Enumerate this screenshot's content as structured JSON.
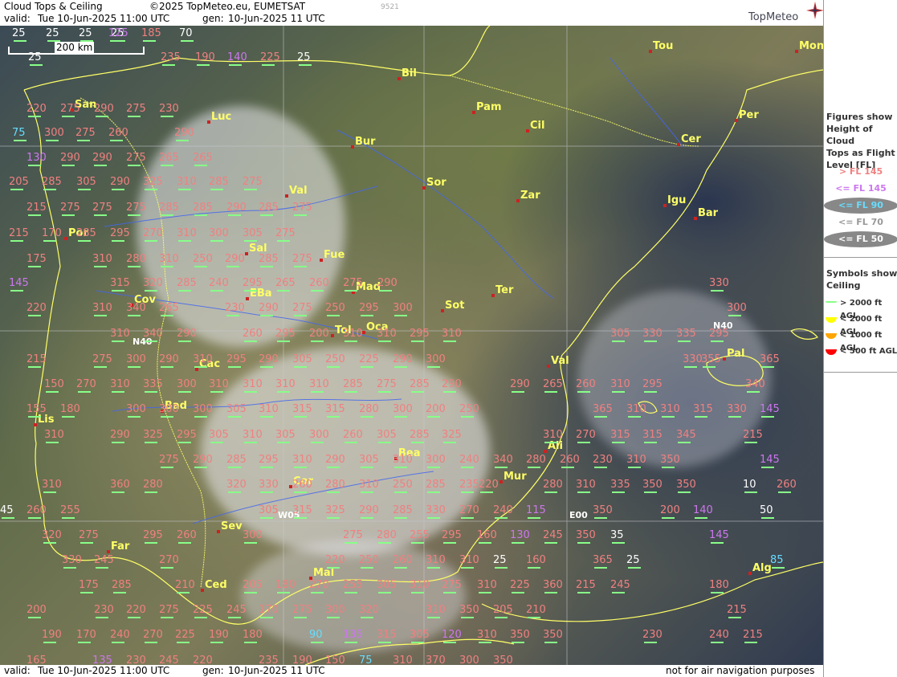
{
  "header": {
    "product": "Cloud Tops & Ceiling",
    "copyright": "©2025 TopMeteo.eu, EUMETSAT",
    "code": "9521",
    "valid_label": "valid:",
    "valid_value": "Tue   10-Jun-2025   11:00 UTC",
    "gen_label": "gen:",
    "gen_value": "10-Jun-2025 11 UTC",
    "logo": "TopMeteo"
  },
  "footer": {
    "valid_label": "valid:",
    "valid_value": "Tue   10-Jun-2025   11:00 UTC",
    "gen_label": "gen:",
    "gen_value": "10-Jun-2025 11 UTC",
    "disclaimer": "not for air navigation purposes"
  },
  "scale": {
    "label": "200 km"
  },
  "grid_labels": [
    {
      "text": "N40"
    },
    {
      "text": "N40"
    },
    {
      "text": "W05"
    },
    {
      "text": "E00"
    }
  ],
  "cities": [
    {
      "name": "Tou"
    },
    {
      "name": "Mon"
    },
    {
      "name": "Bil"
    },
    {
      "name": "Pam"
    },
    {
      "name": "Cil"
    },
    {
      "name": "Per"
    },
    {
      "name": "Luc"
    },
    {
      "name": "Bur"
    },
    {
      "name": "Cer"
    },
    {
      "name": "Sor"
    },
    {
      "name": "Zar"
    },
    {
      "name": "Igu"
    },
    {
      "name": "Bar"
    },
    {
      "name": "Val"
    },
    {
      "name": "Por"
    },
    {
      "name": "Sal"
    },
    {
      "name": "Fue"
    },
    {
      "name": "Mad"
    },
    {
      "name": "Cov"
    },
    {
      "name": "EBa"
    },
    {
      "name": "Ter"
    },
    {
      "name": "Sot"
    },
    {
      "name": "Oca"
    },
    {
      "name": "Tol"
    },
    {
      "name": "Pal"
    },
    {
      "name": "Val"
    },
    {
      "name": "Cac"
    },
    {
      "name": "Bad"
    },
    {
      "name": "Lis"
    },
    {
      "name": "Bea"
    },
    {
      "name": "Ali"
    },
    {
      "name": "Mur"
    },
    {
      "name": "Cor"
    },
    {
      "name": "Sev"
    },
    {
      "name": "Far"
    },
    {
      "name": "Mal"
    },
    {
      "name": "Alg"
    },
    {
      "name": "Ced"
    },
    {
      "name": "San"
    }
  ],
  "values": [
    {
      "v": "25",
      "c": "vlo"
    },
    {
      "v": "25",
      "c": "vlo"
    },
    {
      "v": "25",
      "c": "vlo"
    },
    {
      "v": "25",
      "c": "vlo"
    },
    {
      "v": "125",
      "c": "mid"
    },
    {
      "v": "185",
      "c": "hi"
    },
    {
      "v": "70",
      "c": "vlo"
    },
    {
      "v": "25",
      "c": "vlo"
    },
    {
      "v": "235",
      "c": "hi"
    },
    {
      "v": "190",
      "c": "hi"
    },
    {
      "v": "140",
      "c": "mid"
    },
    {
      "v": "225",
      "c": "hi"
    },
    {
      "v": "25",
      "c": "vlo"
    },
    {
      "v": "220",
      "c": "hi"
    },
    {
      "v": "275",
      "c": "hi"
    },
    {
      "v": "290",
      "c": "hi"
    },
    {
      "v": "275",
      "c": "hi"
    },
    {
      "v": "230",
      "c": "hi"
    },
    {
      "v": "75",
      "c": "lo"
    },
    {
      "v": "300",
      "c": "hi"
    },
    {
      "v": "275",
      "c": "hi"
    },
    {
      "v": "260",
      "c": "hi"
    },
    {
      "v": "290",
      "c": "hi"
    },
    {
      "v": "130",
      "c": "mid"
    },
    {
      "v": "290",
      "c": "hi"
    },
    {
      "v": "290",
      "c": "hi"
    },
    {
      "v": "275",
      "c": "hi"
    },
    {
      "v": "265",
      "c": "hi"
    },
    {
      "v": "265",
      "c": "hi"
    },
    {
      "v": "205",
      "c": "hi"
    },
    {
      "v": "285",
      "c": "hi"
    },
    {
      "v": "305",
      "c": "hi"
    },
    {
      "v": "290",
      "c": "hi"
    },
    {
      "v": "325",
      "c": "hi"
    },
    {
      "v": "310",
      "c": "hi"
    },
    {
      "v": "285",
      "c": "hi"
    },
    {
      "v": "275",
      "c": "hi"
    },
    {
      "v": "215",
      "c": "hi"
    },
    {
      "v": "275",
      "c": "hi"
    },
    {
      "v": "275",
      "c": "hi"
    },
    {
      "v": "275",
      "c": "hi"
    },
    {
      "v": "285",
      "c": "hi"
    },
    {
      "v": "285",
      "c": "hi"
    },
    {
      "v": "290",
      "c": "hi"
    },
    {
      "v": "285",
      "c": "hi"
    },
    {
      "v": "275",
      "c": "hi"
    },
    {
      "v": "215",
      "c": "hi"
    },
    {
      "v": "170",
      "c": "hi"
    },
    {
      "v": "285",
      "c": "hi"
    },
    {
      "v": "295",
      "c": "hi"
    },
    {
      "v": "270",
      "c": "hi"
    },
    {
      "v": "310",
      "c": "hi"
    },
    {
      "v": "300",
      "c": "hi"
    },
    {
      "v": "305",
      "c": "hi"
    },
    {
      "v": "275",
      "c": "hi"
    },
    {
      "v": "175",
      "c": "hi"
    },
    {
      "v": "310",
      "c": "hi"
    },
    {
      "v": "280",
      "c": "hi"
    },
    {
      "v": "310",
      "c": "hi"
    },
    {
      "v": "250",
      "c": "hi"
    },
    {
      "v": "290",
      "c": "hi"
    },
    {
      "v": "285",
      "c": "hi"
    },
    {
      "v": "275",
      "c": "hi"
    },
    {
      "v": "145",
      "c": "mid"
    },
    {
      "v": "315",
      "c": "hi"
    },
    {
      "v": "320",
      "c": "hi"
    },
    {
      "v": "285",
      "c": "hi"
    },
    {
      "v": "240",
      "c": "hi"
    },
    {
      "v": "295",
      "c": "hi"
    },
    {
      "v": "265",
      "c": "hi"
    },
    {
      "v": "260",
      "c": "hi"
    },
    {
      "v": "275",
      "c": "hi"
    },
    {
      "v": "290",
      "c": "hi"
    },
    {
      "v": "330",
      "c": "hi"
    },
    {
      "v": "220",
      "c": "hi"
    },
    {
      "v": "310",
      "c": "hi"
    },
    {
      "v": "340",
      "c": "hi"
    },
    {
      "v": "265",
      "c": "hi"
    },
    {
      "v": "230",
      "c": "hi"
    },
    {
      "v": "290",
      "c": "hi"
    },
    {
      "v": "275",
      "c": "hi"
    },
    {
      "v": "250",
      "c": "hi"
    },
    {
      "v": "295",
      "c": "hi"
    },
    {
      "v": "300",
      "c": "hi"
    },
    {
      "v": "300",
      "c": "hi"
    },
    {
      "v": "310",
      "c": "hi"
    },
    {
      "v": "340",
      "c": "hi"
    },
    {
      "v": "290",
      "c": "hi"
    },
    {
      "v": "260",
      "c": "hi"
    },
    {
      "v": "295",
      "c": "hi"
    },
    {
      "v": "200",
      "c": "hi"
    },
    {
      "v": "310",
      "c": "hi"
    },
    {
      "v": "310",
      "c": "hi"
    },
    {
      "v": "295",
      "c": "hi"
    },
    {
      "v": "310",
      "c": "hi"
    },
    {
      "v": "305",
      "c": "hi"
    },
    {
      "v": "330",
      "c": "hi"
    },
    {
      "v": "335",
      "c": "hi"
    },
    {
      "v": "295",
      "c": "hi"
    },
    {
      "v": "215",
      "c": "hi"
    },
    {
      "v": "275",
      "c": "hi"
    },
    {
      "v": "300",
      "c": "hi"
    },
    {
      "v": "290",
      "c": "hi"
    },
    {
      "v": "310",
      "c": "hi"
    },
    {
      "v": "295",
      "c": "hi"
    },
    {
      "v": "290",
      "c": "hi"
    },
    {
      "v": "305",
      "c": "hi"
    },
    {
      "v": "250",
      "c": "hi"
    },
    {
      "v": "225",
      "c": "hi"
    },
    {
      "v": "290",
      "c": "hi"
    },
    {
      "v": "300",
      "c": "hi"
    },
    {
      "v": "330",
      "c": "hi"
    },
    {
      "v": "355",
      "c": "hi"
    },
    {
      "v": "365",
      "c": "hi"
    },
    {
      "v": "150",
      "c": "hi"
    },
    {
      "v": "270",
      "c": "hi"
    },
    {
      "v": "310",
      "c": "hi"
    },
    {
      "v": "335",
      "c": "hi"
    },
    {
      "v": "300",
      "c": "hi"
    },
    {
      "v": "310",
      "c": "hi"
    },
    {
      "v": "310",
      "c": "hi"
    },
    {
      "v": "310",
      "c": "hi"
    },
    {
      "v": "310",
      "c": "hi"
    },
    {
      "v": "285",
      "c": "hi"
    },
    {
      "v": "275",
      "c": "hi"
    },
    {
      "v": "285",
      "c": "hi"
    },
    {
      "v": "290",
      "c": "hi"
    },
    {
      "v": "290",
      "c": "hi"
    },
    {
      "v": "265",
      "c": "hi"
    },
    {
      "v": "260",
      "c": "hi"
    },
    {
      "v": "310",
      "c": "hi"
    },
    {
      "v": "295",
      "c": "hi"
    },
    {
      "v": "340",
      "c": "hi"
    },
    {
      "v": "155",
      "c": "hi"
    },
    {
      "v": "180",
      "c": "hi"
    },
    {
      "v": "300",
      "c": "hi"
    },
    {
      "v": "300",
      "c": "hi"
    },
    {
      "v": "300",
      "c": "hi"
    },
    {
      "v": "305",
      "c": "hi"
    },
    {
      "v": "310",
      "c": "hi"
    },
    {
      "v": "315",
      "c": "hi"
    },
    {
      "v": "315",
      "c": "hi"
    },
    {
      "v": "280",
      "c": "hi"
    },
    {
      "v": "300",
      "c": "hi"
    },
    {
      "v": "200",
      "c": "hi"
    },
    {
      "v": "250",
      "c": "hi"
    },
    {
      "v": "365",
      "c": "hi"
    },
    {
      "v": "310",
      "c": "hi"
    },
    {
      "v": "310",
      "c": "hi"
    },
    {
      "v": "315",
      "c": "hi"
    },
    {
      "v": "330",
      "c": "hi"
    },
    {
      "v": "145",
      "c": "mid"
    },
    {
      "v": "310",
      "c": "hi"
    },
    {
      "v": "290",
      "c": "hi"
    },
    {
      "v": "325",
      "c": "hi"
    },
    {
      "v": "295",
      "c": "hi"
    },
    {
      "v": "305",
      "c": "hi"
    },
    {
      "v": "310",
      "c": "hi"
    },
    {
      "v": "305",
      "c": "hi"
    },
    {
      "v": "300",
      "c": "hi"
    },
    {
      "v": "260",
      "c": "hi"
    },
    {
      "v": "305",
      "c": "hi"
    },
    {
      "v": "285",
      "c": "hi"
    },
    {
      "v": "325",
      "c": "hi"
    },
    {
      "v": "310",
      "c": "hi"
    },
    {
      "v": "270",
      "c": "hi"
    },
    {
      "v": "315",
      "c": "hi"
    },
    {
      "v": "315",
      "c": "hi"
    },
    {
      "v": "345",
      "c": "hi"
    },
    {
      "v": "215",
      "c": "hi"
    },
    {
      "v": "275",
      "c": "hi"
    },
    {
      "v": "290",
      "c": "hi"
    },
    {
      "v": "285",
      "c": "hi"
    },
    {
      "v": "295",
      "c": "hi"
    },
    {
      "v": "310",
      "c": "hi"
    },
    {
      "v": "290",
      "c": "hi"
    },
    {
      "v": "305",
      "c": "hi"
    },
    {
      "v": "310",
      "c": "hi"
    },
    {
      "v": "300",
      "c": "hi"
    },
    {
      "v": "240",
      "c": "hi"
    },
    {
      "v": "340",
      "c": "hi"
    },
    {
      "v": "280",
      "c": "hi"
    },
    {
      "v": "260",
      "c": "hi"
    },
    {
      "v": "230",
      "c": "hi"
    },
    {
      "v": "310",
      "c": "hi"
    },
    {
      "v": "350",
      "c": "hi"
    },
    {
      "v": "145",
      "c": "mid"
    },
    {
      "v": "310",
      "c": "hi"
    },
    {
      "v": "360",
      "c": "hi"
    },
    {
      "v": "280",
      "c": "hi"
    },
    {
      "v": "320",
      "c": "hi"
    },
    {
      "v": "330",
      "c": "hi"
    },
    {
      "v": "260",
      "c": "hi"
    },
    {
      "v": "280",
      "c": "hi"
    },
    {
      "v": "310",
      "c": "hi"
    },
    {
      "v": "250",
      "c": "hi"
    },
    {
      "v": "285",
      "c": "hi"
    },
    {
      "v": "235",
      "c": "hi"
    },
    {
      "v": "220",
      "c": "hi"
    },
    {
      "v": "280",
      "c": "hi"
    },
    {
      "v": "310",
      "c": "hi"
    },
    {
      "v": "335",
      "c": "hi"
    },
    {
      "v": "350",
      "c": "hi"
    },
    {
      "v": "350",
      "c": "hi"
    },
    {
      "v": "10",
      "c": "vlo"
    },
    {
      "v": "260",
      "c": "hi"
    },
    {
      "v": "45",
      "c": "vlo"
    },
    {
      "v": "260",
      "c": "hi"
    },
    {
      "v": "255",
      "c": "hi"
    },
    {
      "v": "305",
      "c": "hi"
    },
    {
      "v": "315",
      "c": "hi"
    },
    {
      "v": "325",
      "c": "hi"
    },
    {
      "v": "290",
      "c": "hi"
    },
    {
      "v": "285",
      "c": "hi"
    },
    {
      "v": "330",
      "c": "hi"
    },
    {
      "v": "270",
      "c": "hi"
    },
    {
      "v": "240",
      "c": "hi"
    },
    {
      "v": "115",
      "c": "mid"
    },
    {
      "v": "350",
      "c": "hi"
    },
    {
      "v": "200",
      "c": "hi"
    },
    {
      "v": "140",
      "c": "mid"
    },
    {
      "v": "50",
      "c": "vlo"
    },
    {
      "v": "320",
      "c": "hi"
    },
    {
      "v": "275",
      "c": "hi"
    },
    {
      "v": "295",
      "c": "hi"
    },
    {
      "v": "260",
      "c": "hi"
    },
    {
      "v": "300",
      "c": "hi"
    },
    {
      "v": "275",
      "c": "hi"
    },
    {
      "v": "280",
      "c": "hi"
    },
    {
      "v": "255",
      "c": "hi"
    },
    {
      "v": "295",
      "c": "hi"
    },
    {
      "v": "160",
      "c": "hi"
    },
    {
      "v": "130",
      "c": "mid"
    },
    {
      "v": "245",
      "c": "hi"
    },
    {
      "v": "350",
      "c": "hi"
    },
    {
      "v": "35",
      "c": "vlo"
    },
    {
      "v": "145",
      "c": "mid"
    },
    {
      "v": "330",
      "c": "hi"
    },
    {
      "v": "245",
      "c": "hi"
    },
    {
      "v": "270",
      "c": "hi"
    },
    {
      "v": "220",
      "c": "hi"
    },
    {
      "v": "250",
      "c": "hi"
    },
    {
      "v": "260",
      "c": "hi"
    },
    {
      "v": "310",
      "c": "hi"
    },
    {
      "v": "310",
      "c": "hi"
    },
    {
      "v": "25",
      "c": "vlo"
    },
    {
      "v": "160",
      "c": "hi"
    },
    {
      "v": "365",
      "c": "hi"
    },
    {
      "v": "25",
      "c": "vlo"
    },
    {
      "v": "85",
      "c": "lo"
    },
    {
      "v": "175",
      "c": "hi"
    },
    {
      "v": "285",
      "c": "hi"
    },
    {
      "v": "210",
      "c": "hi"
    },
    {
      "v": "205",
      "c": "hi"
    },
    {
      "v": "180",
      "c": "hi"
    },
    {
      "v": "270",
      "c": "hi"
    },
    {
      "v": "255",
      "c": "hi"
    },
    {
      "v": "305",
      "c": "hi"
    },
    {
      "v": "310",
      "c": "hi"
    },
    {
      "v": "275",
      "c": "hi"
    },
    {
      "v": "310",
      "c": "hi"
    },
    {
      "v": "225",
      "c": "hi"
    },
    {
      "v": "360",
      "c": "hi"
    },
    {
      "v": "215",
      "c": "hi"
    },
    {
      "v": "245",
      "c": "hi"
    },
    {
      "v": "180",
      "c": "hi"
    },
    {
      "v": "200",
      "c": "hi"
    },
    {
      "v": "230",
      "c": "hi"
    },
    {
      "v": "220",
      "c": "hi"
    },
    {
      "v": "275",
      "c": "hi"
    },
    {
      "v": "225",
      "c": "hi"
    },
    {
      "v": "245",
      "c": "hi"
    },
    {
      "v": "170",
      "c": "hi"
    },
    {
      "v": "275",
      "c": "hi"
    },
    {
      "v": "300",
      "c": "hi"
    },
    {
      "v": "320",
      "c": "hi"
    },
    {
      "v": "310",
      "c": "hi"
    },
    {
      "v": "350",
      "c": "hi"
    },
    {
      "v": "205",
      "c": "hi"
    },
    {
      "v": "210",
      "c": "hi"
    },
    {
      "v": "215",
      "c": "hi"
    },
    {
      "v": "190",
      "c": "hi"
    },
    {
      "v": "170",
      "c": "hi"
    },
    {
      "v": "240",
      "c": "hi"
    },
    {
      "v": "270",
      "c": "hi"
    },
    {
      "v": "225",
      "c": "hi"
    },
    {
      "v": "190",
      "c": "hi"
    },
    {
      "v": "180",
      "c": "hi"
    },
    {
      "v": "90",
      "c": "lo"
    },
    {
      "v": "135",
      "c": "mid"
    },
    {
      "v": "315",
      "c": "hi"
    },
    {
      "v": "305",
      "c": "hi"
    },
    {
      "v": "120",
      "c": "mid"
    },
    {
      "v": "310",
      "c": "hi"
    },
    {
      "v": "350",
      "c": "hi"
    },
    {
      "v": "350",
      "c": "hi"
    },
    {
      "v": "230",
      "c": "hi"
    },
    {
      "v": "240",
      "c": "hi"
    },
    {
      "v": "215",
      "c": "hi"
    },
    {
      "v": "165",
      "c": "hi"
    },
    {
      "v": "135",
      "c": "mid"
    },
    {
      "v": "230",
      "c": "hi"
    },
    {
      "v": "245",
      "c": "hi"
    },
    {
      "v": "220",
      "c": "hi"
    },
    {
      "v": "235",
      "c": "hi"
    },
    {
      "v": "190",
      "c": "hi"
    },
    {
      "v": "150",
      "c": "hi"
    },
    {
      "v": "75",
      "c": "lo"
    },
    {
      "v": "310",
      "c": "hi"
    },
    {
      "v": "370",
      "c": "hi"
    },
    {
      "v": "300",
      "c": "hi"
    },
    {
      "v": "350",
      "c": "hi"
    }
  ],
  "legend": {
    "tops_title": [
      "Figures show",
      "Height of Cloud",
      "Tops as Flight",
      "Level  [FL]"
    ],
    "tops_items": [
      {
        "label": "> FL 145",
        "color": "#f08080",
        "oval": false
      },
      {
        "label": "<= FL 145",
        "color": "#cc77ee",
        "oval": false
      },
      {
        "label": "<= FL 90",
        "color": "#66ddff",
        "oval": true
      },
      {
        "label": "<= FL 70",
        "color": "#999999",
        "oval": false
      },
      {
        "label": "<= FL 50",
        "color": "#ffffff",
        "oval": true
      }
    ],
    "ceiling_title": [
      "Symbols show",
      "Ceiling"
    ],
    "ceiling_items": [
      {
        "label": "> 2000 ft AGL",
        "color": "#88ff88"
      },
      {
        "label": "< 2000 ft AGL",
        "color": "#ffff00"
      },
      {
        "label": "< 1000 ft AGL",
        "color": "#ffa500"
      },
      {
        "label": "< 500 ft AGL",
        "color": "#ff0000"
      }
    ]
  }
}
